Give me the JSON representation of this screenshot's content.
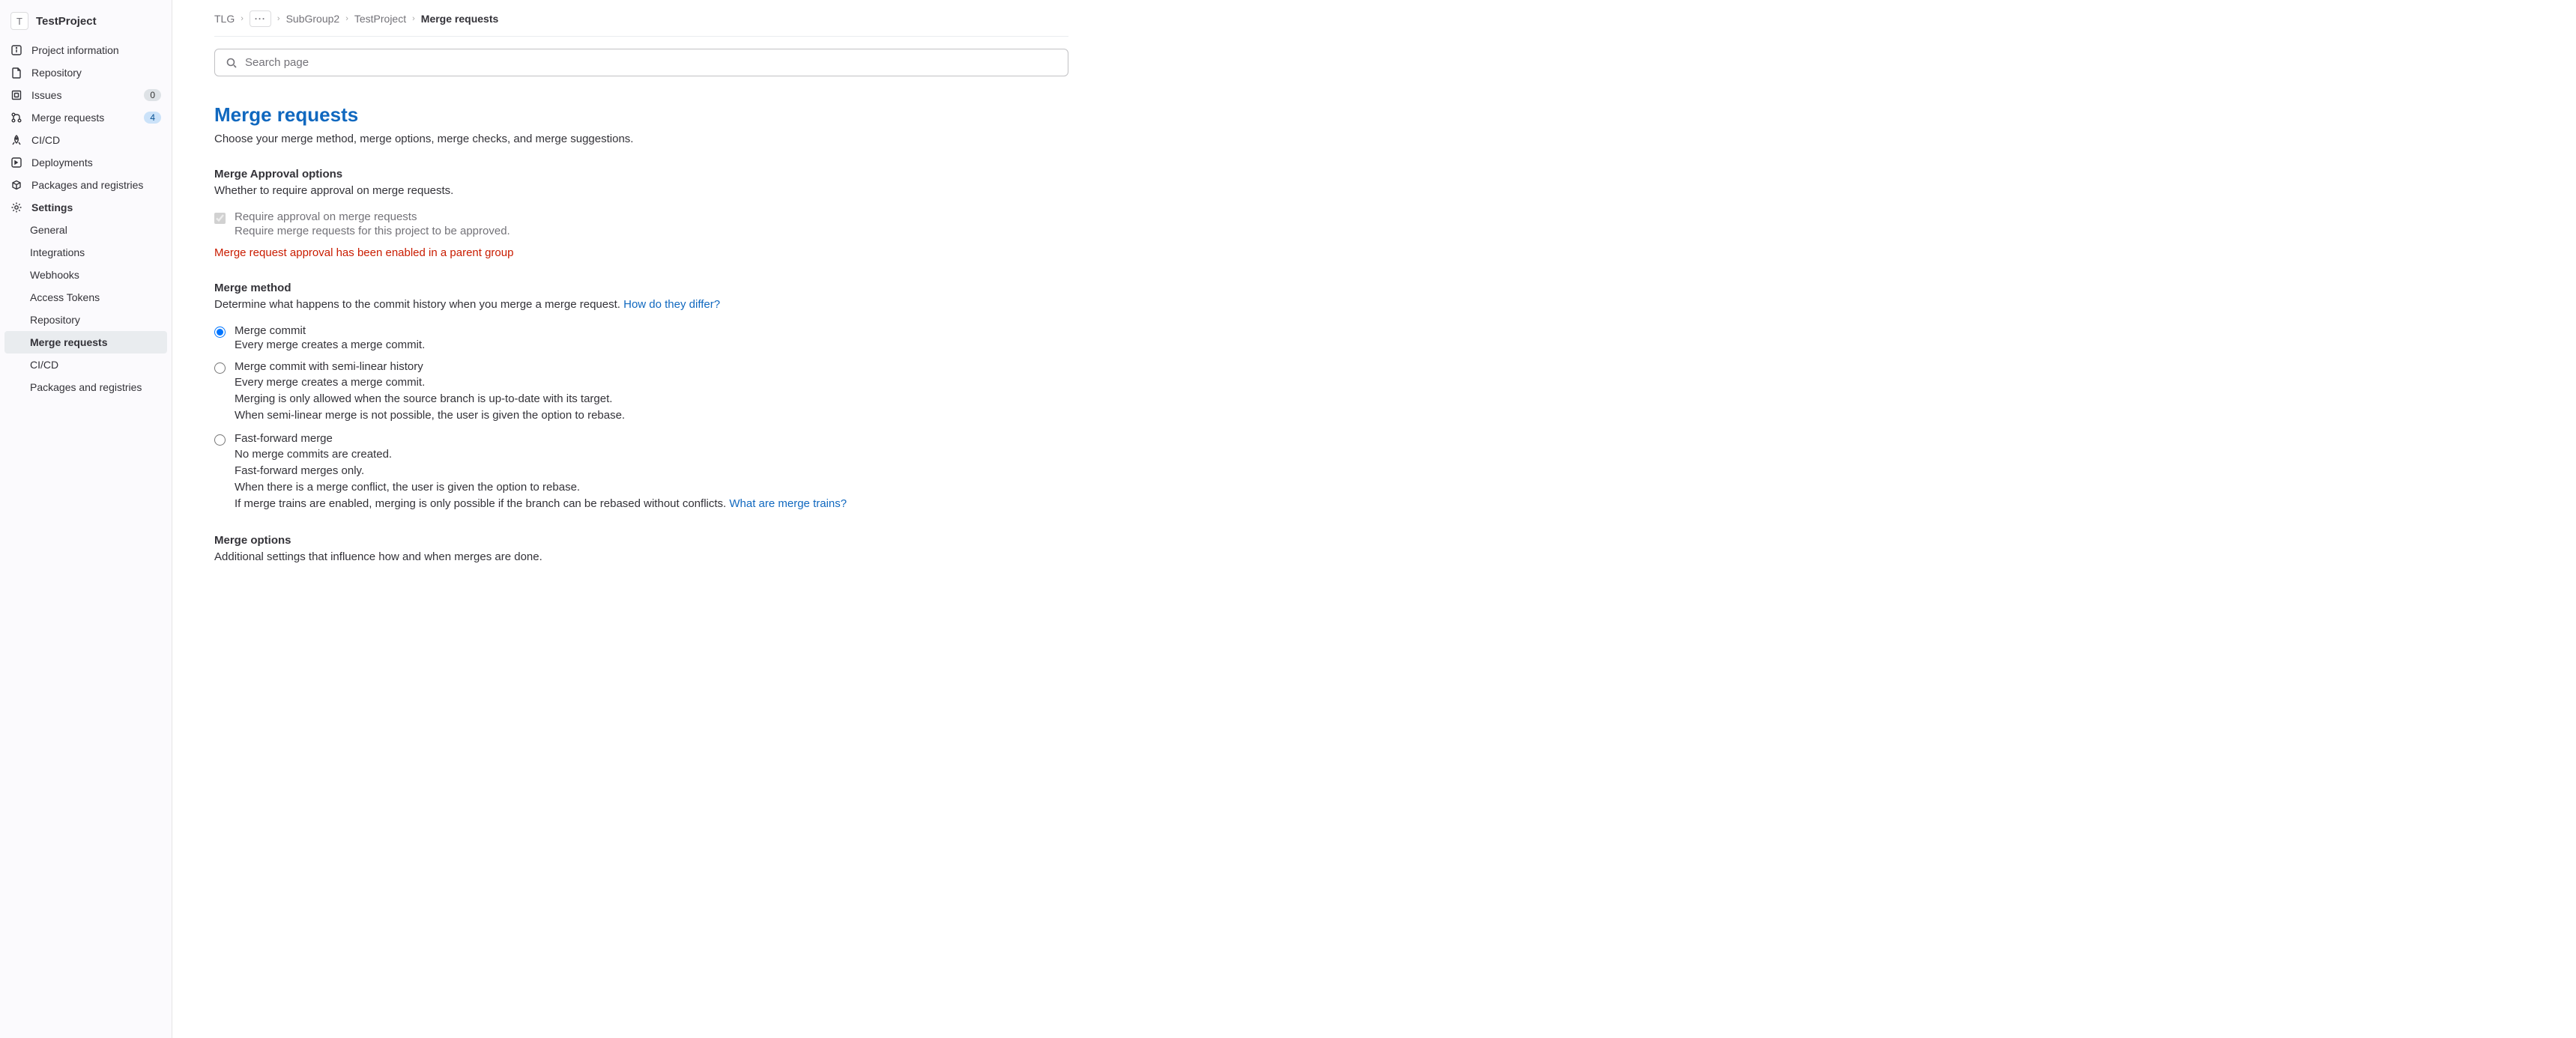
{
  "project": {
    "avatar_letter": "T",
    "name": "TestProject"
  },
  "sidebar": {
    "items": [
      {
        "label": "Project information"
      },
      {
        "label": "Repository"
      },
      {
        "label": "Issues",
        "badge": "0"
      },
      {
        "label": "Merge requests",
        "badge": "4"
      },
      {
        "label": "CI/CD"
      },
      {
        "label": "Deployments"
      },
      {
        "label": "Packages and registries"
      },
      {
        "label": "Settings"
      }
    ],
    "settings_sub": [
      {
        "label": "General"
      },
      {
        "label": "Integrations"
      },
      {
        "label": "Webhooks"
      },
      {
        "label": "Access Tokens"
      },
      {
        "label": "Repository"
      },
      {
        "label": "Merge requests"
      },
      {
        "label": "CI/CD"
      },
      {
        "label": "Packages and registries"
      }
    ]
  },
  "breadcrumb": {
    "items": [
      "TLG",
      "SubGroup2",
      "TestProject",
      "Merge requests"
    ]
  },
  "search": {
    "placeholder": "Search page"
  },
  "page": {
    "title": "Merge requests",
    "desc": "Choose your merge method, merge options, merge checks, and merge suggestions."
  },
  "approval": {
    "title": "Merge Approval options",
    "desc": "Whether to require approval on merge requests.",
    "opt_label": "Require approval on merge requests",
    "opt_sub": "Require merge requests for this project to be approved.",
    "warning": "Merge request approval has been enabled in a parent group"
  },
  "method": {
    "title": "Merge method",
    "desc": "Determine what happens to the commit history when you merge a merge request. ",
    "link": "How do they differ?",
    "options": [
      {
        "label": "Merge commit",
        "sub": "Every merge creates a merge commit."
      },
      {
        "label": "Merge commit with semi-linear history",
        "sub": "Every merge creates a merge commit.\nMerging is only allowed when the source branch is up-to-date with its target.\nWhen semi-linear merge is not possible, the user is given the option to rebase."
      },
      {
        "label": "Fast-forward merge",
        "sub": "No merge commits are created.\nFast-forward merges only.\nWhen there is a merge conflict, the user is given the option to rebase.\nIf merge trains are enabled, merging is only possible if the branch can be rebased without conflicts. ",
        "link": "What are merge trains?"
      }
    ]
  },
  "merge_options": {
    "title": "Merge options",
    "desc": "Additional settings that influence how and when merges are done."
  }
}
